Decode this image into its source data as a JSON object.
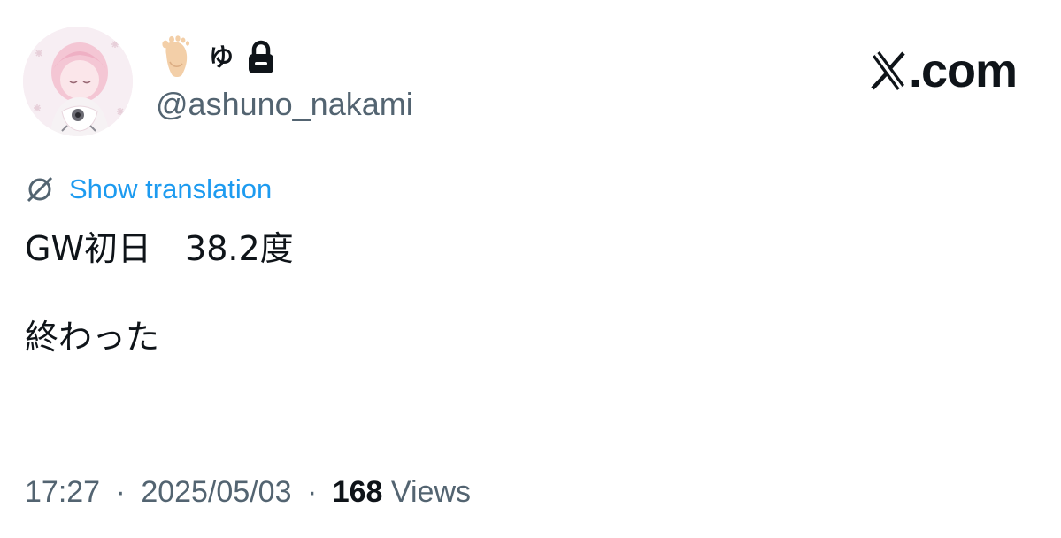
{
  "author": {
    "display_name": "ゆ",
    "handle": "@ashuno_nakami",
    "protected": true,
    "name_emoji": "foot-icon"
  },
  "brand": {
    "suffix": ".com",
    "logo": "x-logo-icon"
  },
  "translation": {
    "label": "Show translation"
  },
  "tweet": {
    "lines": [
      "GW初日　38.2度",
      "",
      "終わった"
    ]
  },
  "meta": {
    "time": "17:27",
    "date": "2025/05/03",
    "views_count": "168",
    "views_label": "Views",
    "separator": "·"
  },
  "colors": {
    "text": "#0f1419",
    "secondary": "#536471",
    "link": "#1d9bf0",
    "avatar_bg": "#f6eef2"
  }
}
